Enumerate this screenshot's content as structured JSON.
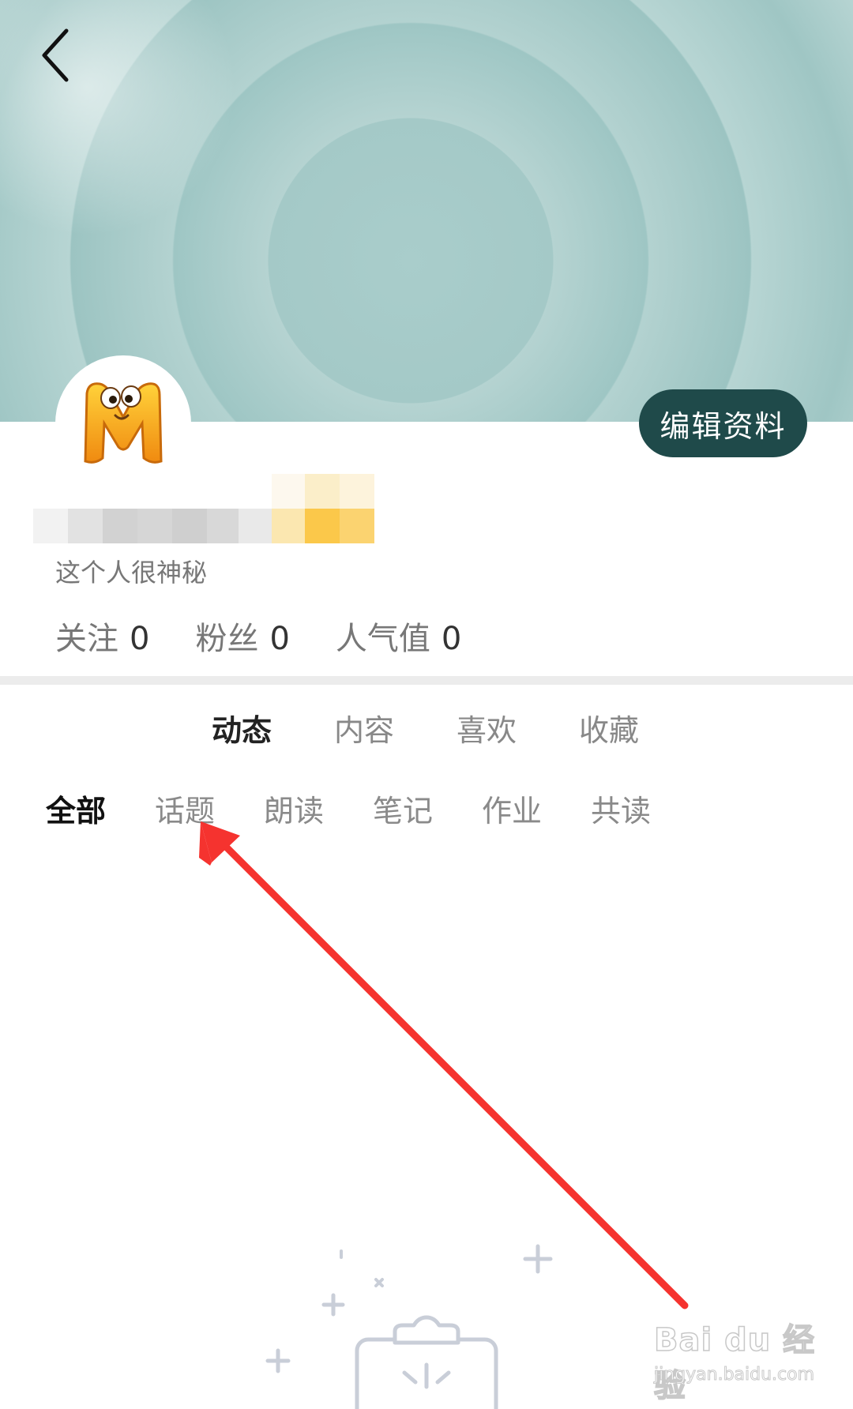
{
  "header": {
    "back_icon": "chevron-left-icon",
    "edit_profile_label": "编辑资料"
  },
  "profile": {
    "avatar_icon": "m-mascot-avatar",
    "username": "",
    "bio": "这个人很神秘"
  },
  "stats": [
    {
      "label": "关注",
      "value": "0"
    },
    {
      "label": "粉丝",
      "value": "0"
    },
    {
      "label": "人气值",
      "value": "0"
    }
  ],
  "main_tabs": [
    {
      "label": "动态",
      "active": true
    },
    {
      "label": "内容",
      "active": false
    },
    {
      "label": "喜欢",
      "active": false
    },
    {
      "label": "收藏",
      "active": false
    }
  ],
  "sub_tabs": [
    {
      "label": "全部",
      "active": true
    },
    {
      "label": "话题",
      "active": false
    },
    {
      "label": "朗读",
      "active": false
    },
    {
      "label": "笔记",
      "active": false
    },
    {
      "label": "作业",
      "active": false
    },
    {
      "label": "共读",
      "active": false
    }
  ],
  "annotation": {
    "icon": "red-arrow-annotation",
    "color": "#f5332f"
  },
  "empty_state": {
    "icon": "empty-clipboard-icon"
  },
  "watermark": {
    "logo_text": "Bai du 经验",
    "url_text": "jingyan.baidu.com"
  },
  "colors": {
    "edit_button_bg": "#1f4a4a",
    "active_tab": "#222222",
    "inactive_tab": "#888888"
  }
}
